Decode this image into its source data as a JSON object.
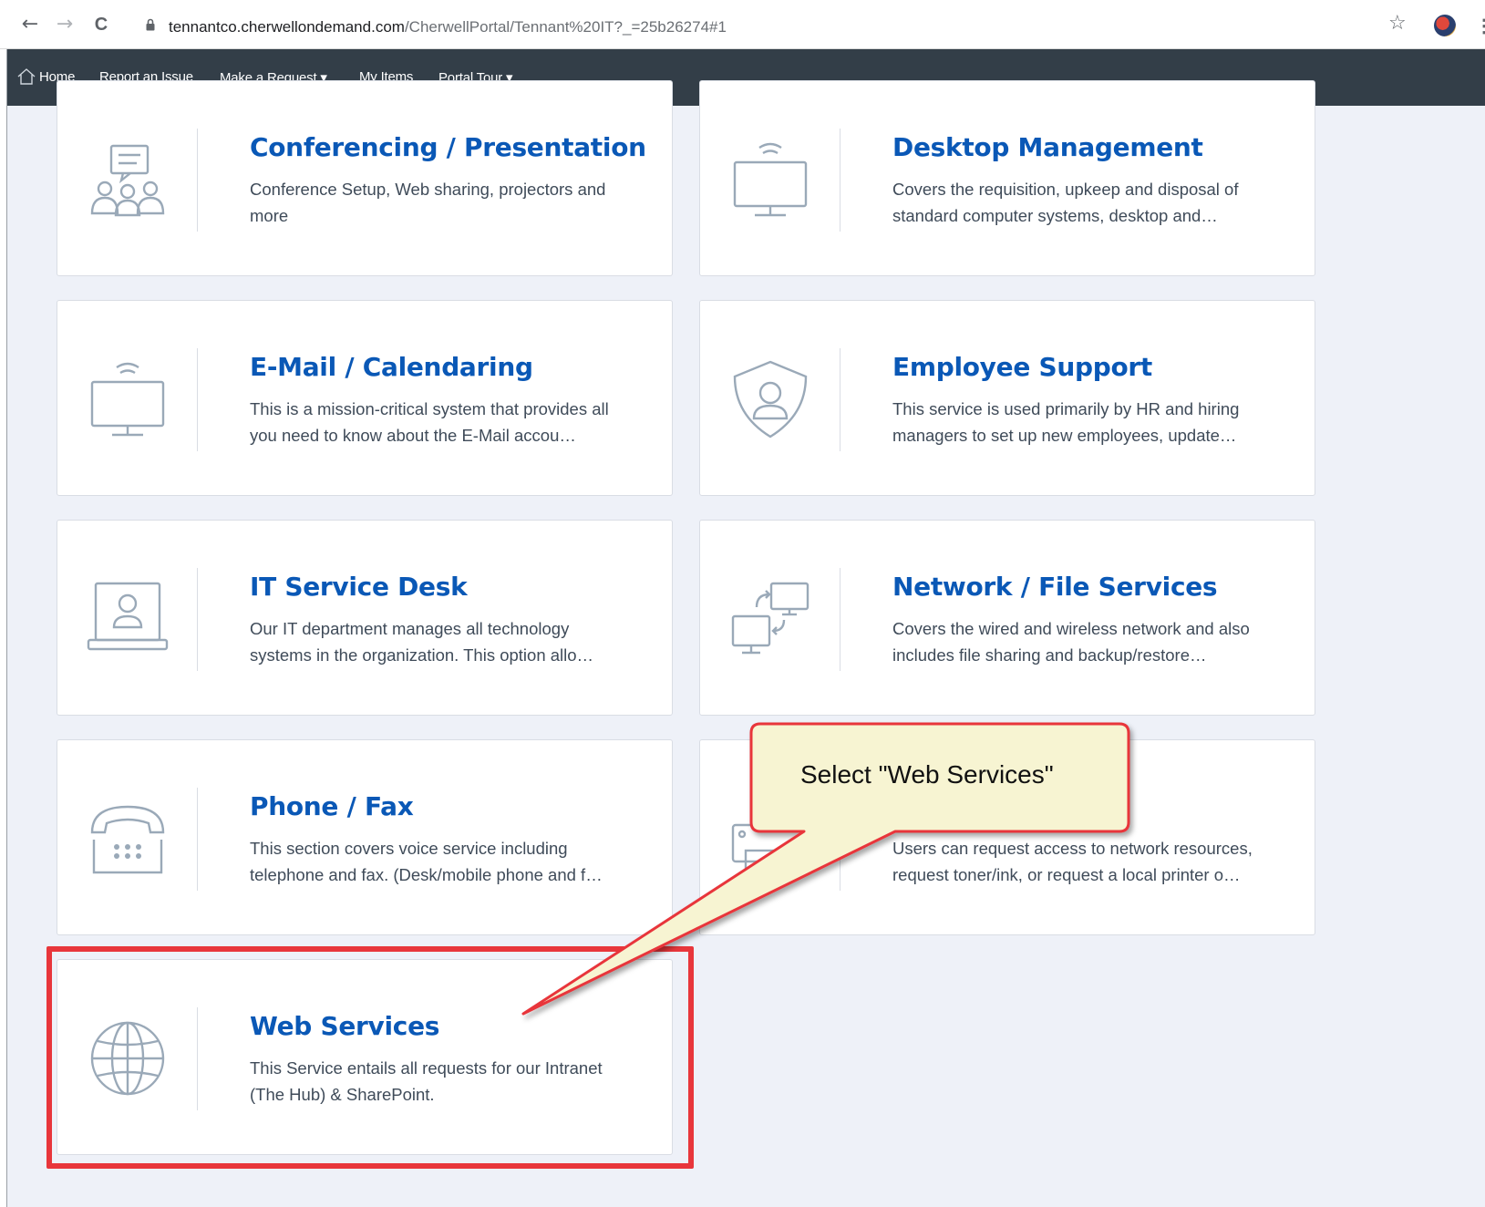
{
  "browser": {
    "url_host": "tennantco.cherwellondemand.com",
    "url_path": "/CherwellPortal/Tennant%20IT?_=25b26274#1",
    "back_glyph": "←",
    "forward_glyph": "→",
    "reload_glyph": "C",
    "star_glyph": "☆",
    "menu_glyph": "⋮"
  },
  "nav": {
    "home": "Home",
    "report": "Report an Issue",
    "request": "Make a Request ▾",
    "my_items": "My Items",
    "tour": "Portal Tour ▾"
  },
  "cards": [
    {
      "title": "Conferencing / Presentation",
      "desc": "Conference Setup, Web sharing, projectors and more",
      "icon": "people-chat-icon"
    },
    {
      "title": "Desktop Management",
      "desc": "Covers the requisition, upkeep and disposal of standard computer systems, desktop and…",
      "icon": "wifi-monitor-icon"
    },
    {
      "title": "E-Mail / Calendaring",
      "desc": "This is a mission-critical system that provides all you need to know about the E-Mail accou…",
      "icon": "wifi-monitor-icon"
    },
    {
      "title": "Employee Support",
      "desc": "This service is used primarily by HR and hiring managers to set up new employees, update…",
      "icon": "shield-user-icon"
    },
    {
      "title": "IT Service Desk",
      "desc": "Our IT department manages all technology systems in the organization. This option allo…",
      "icon": "laptop-user-icon"
    },
    {
      "title": "Network / File Services",
      "desc": "Covers the wired and wireless network and also includes file sharing and backup/restore…",
      "icon": "network-transfer-icon"
    },
    {
      "title": "Phone / Fax",
      "desc": "This section covers voice service including telephone and fax. (Desk/mobile phone and f…",
      "icon": "telephone-icon"
    },
    {
      "title": "",
      "desc": "Users can request access to network resources, request toner/ink, or request a local printer o…",
      "icon": "printer-icon"
    },
    {
      "title": "Web Services",
      "desc": "This Service entails all requests for our Intranet (The Hub) & SharePoint.",
      "icon": "globe-icon"
    }
  ],
  "callout": {
    "text": "Select \"Web Services\"",
    "fill": "#f7f4d2",
    "border": "#e8363b"
  },
  "colors": {
    "nav_bg": "#333e48",
    "title": "#0a58b6",
    "content_bg": "#eef1f8",
    "icon": "#9aa9b8",
    "highlight": "#e8363b"
  }
}
